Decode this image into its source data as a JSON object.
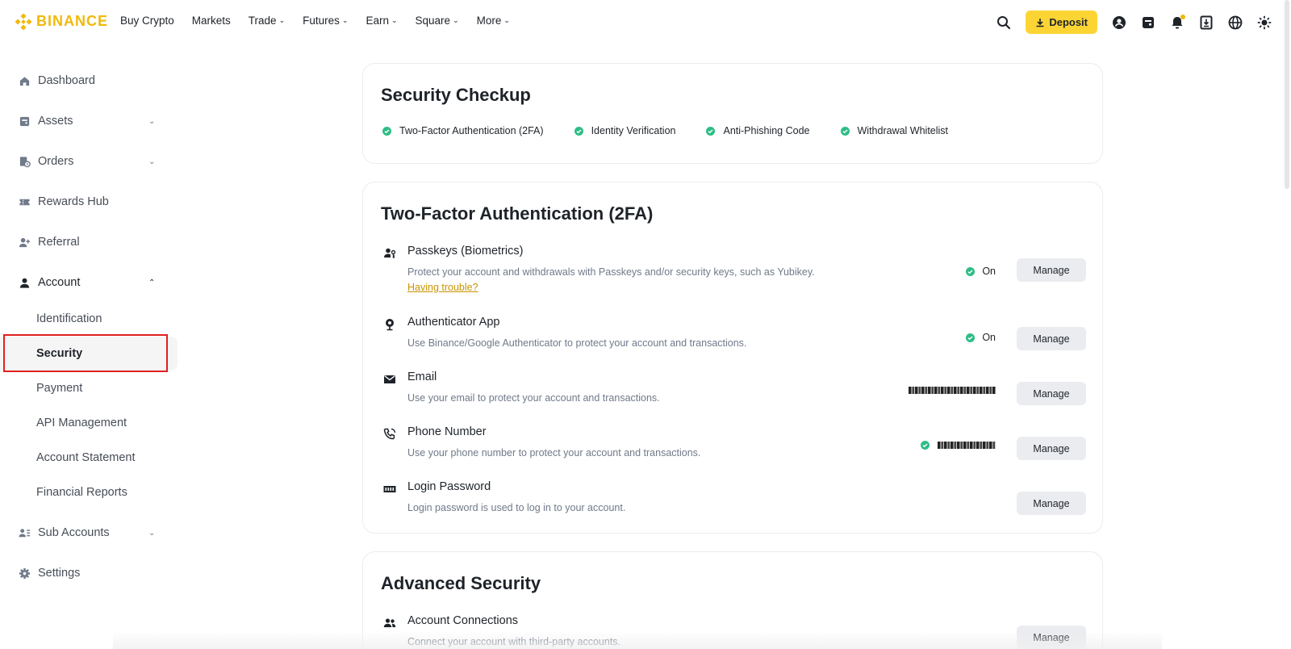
{
  "header": {
    "logo_text": "BINANCE",
    "nav": [
      {
        "label": "Buy Crypto",
        "has_dropdown": false
      },
      {
        "label": "Markets",
        "has_dropdown": false
      },
      {
        "label": "Trade",
        "has_dropdown": true
      },
      {
        "label": "Futures",
        "has_dropdown": true
      },
      {
        "label": "Earn",
        "has_dropdown": true
      },
      {
        "label": "Square",
        "has_dropdown": true
      },
      {
        "label": "More",
        "has_dropdown": true
      }
    ],
    "deposit_label": "Deposit",
    "icons": [
      "search-icon",
      "deposit-download-icon",
      "user-profile-icon",
      "wallet-icon",
      "notification-bell-icon",
      "download-app-icon",
      "language-globe-icon",
      "theme-toggle-icon"
    ]
  },
  "sidebar": {
    "items": [
      {
        "label": "Dashboard",
        "icon": "home-icon"
      },
      {
        "label": "Assets",
        "icon": "wallet-icon"
      },
      {
        "label": "Orders",
        "icon": "orders-icon"
      },
      {
        "label": "Rewards Hub",
        "icon": "ticket-icon"
      },
      {
        "label": "Referral",
        "icon": "add-user-icon"
      },
      {
        "label": "Account",
        "icon": "person-icon"
      },
      {
        "label": "Sub Accounts",
        "icon": "sub-accounts-icon"
      },
      {
        "label": "Settings",
        "icon": "gear-icon"
      }
    ],
    "account_sub": [
      "Identification",
      "Security",
      "Payment",
      "API Management",
      "Account Statement",
      "Financial Reports"
    ],
    "selected": "Security"
  },
  "security_checkup": {
    "title": "Security Checkup",
    "checks": [
      "Two-Factor Authentication (2FA)",
      "Identity Verification",
      "Anti-Phishing Code",
      "Withdrawal Whitelist"
    ],
    "check_color": "#2ebd85"
  },
  "two_fa": {
    "title": "Two-Factor Authentication (2FA)",
    "rows": [
      {
        "title": "Passkeys (Biometrics)",
        "desc": "Protect your account and withdrawals with Passkeys and/or security keys, such as Yubikey.",
        "link": "Having trouble?",
        "status": "On",
        "button": "Manage",
        "icon": "passkey-icon"
      },
      {
        "title": "Authenticator App",
        "desc": "Use Binance/Google Authenticator to protect your account and transactions.",
        "status": "On",
        "button": "Manage",
        "icon": "authenticator-icon"
      },
      {
        "title": "Email",
        "desc": "Use your email to protect your account and transactions.",
        "button": "Manage",
        "icon": "email-icon"
      },
      {
        "title": "Phone Number",
        "desc": "Use your phone number to protect your account and transactions.",
        "button": "Manage",
        "icon": "phone-icon"
      },
      {
        "title": "Login Password",
        "desc": "Login password is used to log in to your account.",
        "button": "Manage",
        "icon": "password-icon"
      }
    ]
  },
  "advanced": {
    "title": "Advanced Security",
    "rows": [
      {
        "title": "Account Connections",
        "desc": "Connect your account with third-party accounts.",
        "button": "Manage",
        "icon": "connections-icon"
      }
    ]
  },
  "colors": {
    "brand": "#f0b90b",
    "deposit_bg": "#fcd535",
    "success": "#2ebd85",
    "link": "#c99400",
    "highlight": "#e02020"
  }
}
